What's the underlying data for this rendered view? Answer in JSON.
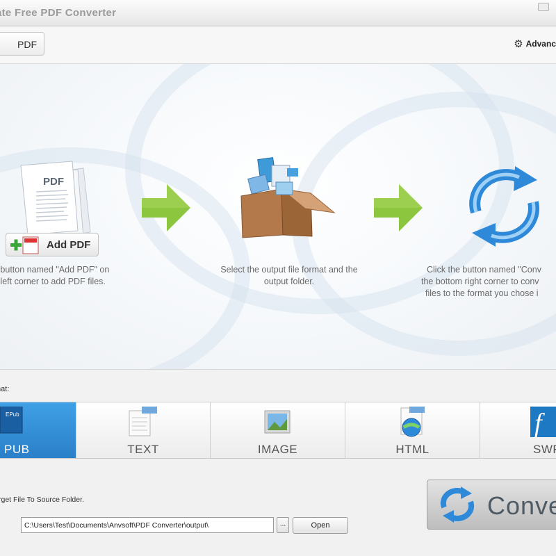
{
  "window": {
    "title": "ate Free PDF Converter"
  },
  "toolbar": {
    "add_pdf_label": "PDF",
    "advanced_label": "Advanc"
  },
  "guide": {
    "step1_button_label": "Add PDF",
    "step1_text_line1": "e button named \"Add PDF\" on",
    "step1_text_line2": "p left corner to add PDF files.",
    "step2_text_line1": "Select the output file format and the",
    "step2_text_line2": "output folder.",
    "step3_text_line1": "Click the button named \"Conv",
    "step3_text_line2": "the bottom right corner to conv",
    "step3_text_line3": "files to the format you chose i"
  },
  "format": {
    "label": "mat:",
    "tabs": [
      {
        "label": "PUB",
        "active": true
      },
      {
        "label": "TEXT",
        "active": false
      },
      {
        "label": "IMAGE",
        "active": false
      },
      {
        "label": "HTML",
        "active": false
      },
      {
        "label": "SWF",
        "active": false
      }
    ]
  },
  "output": {
    "save_to_source_label": "rget File To Source Folder.",
    "path_value": "C:\\Users\\Test\\Documents\\Anvsoft\\PDF Converter\\output\\",
    "browse_label": "...",
    "open_label": "Open"
  },
  "convert": {
    "label": "Conve"
  },
  "colors": {
    "accent": "#2b8ad6",
    "arrow_green": "#8cc63f",
    "active_tab": "#3396dc"
  }
}
